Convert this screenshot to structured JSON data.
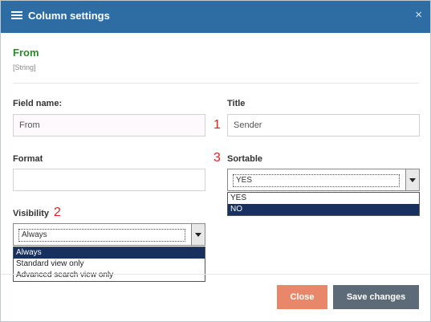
{
  "dialog": {
    "title": "Column settings",
    "close_glyph": "×"
  },
  "field": {
    "name": "From",
    "type": "[String]"
  },
  "labels": {
    "field_name": "Field name:",
    "title": "Title",
    "format": "Format",
    "sortable": "Sortable",
    "visibility": "Visibility"
  },
  "inputs": {
    "field_name_value": "From",
    "title_value": "Sender",
    "format_value": ""
  },
  "annotations": {
    "n1": "1",
    "n2": "2",
    "n3": "3"
  },
  "sortable": {
    "selected": "YES",
    "options": [
      "YES",
      "NO"
    ]
  },
  "visibility": {
    "selected": "Always",
    "options": [
      "Always",
      "Standard view only",
      "Advanced search view only"
    ]
  },
  "buttons": {
    "close": "Close",
    "save": "Save changes"
  },
  "colors": {
    "header": "#2e6da4",
    "field_title": "#2a8a2a",
    "close_btn": "#e8876a",
    "save_btn": "#5d6b78",
    "highlight": "#17305e",
    "annotation": "#e02020"
  }
}
